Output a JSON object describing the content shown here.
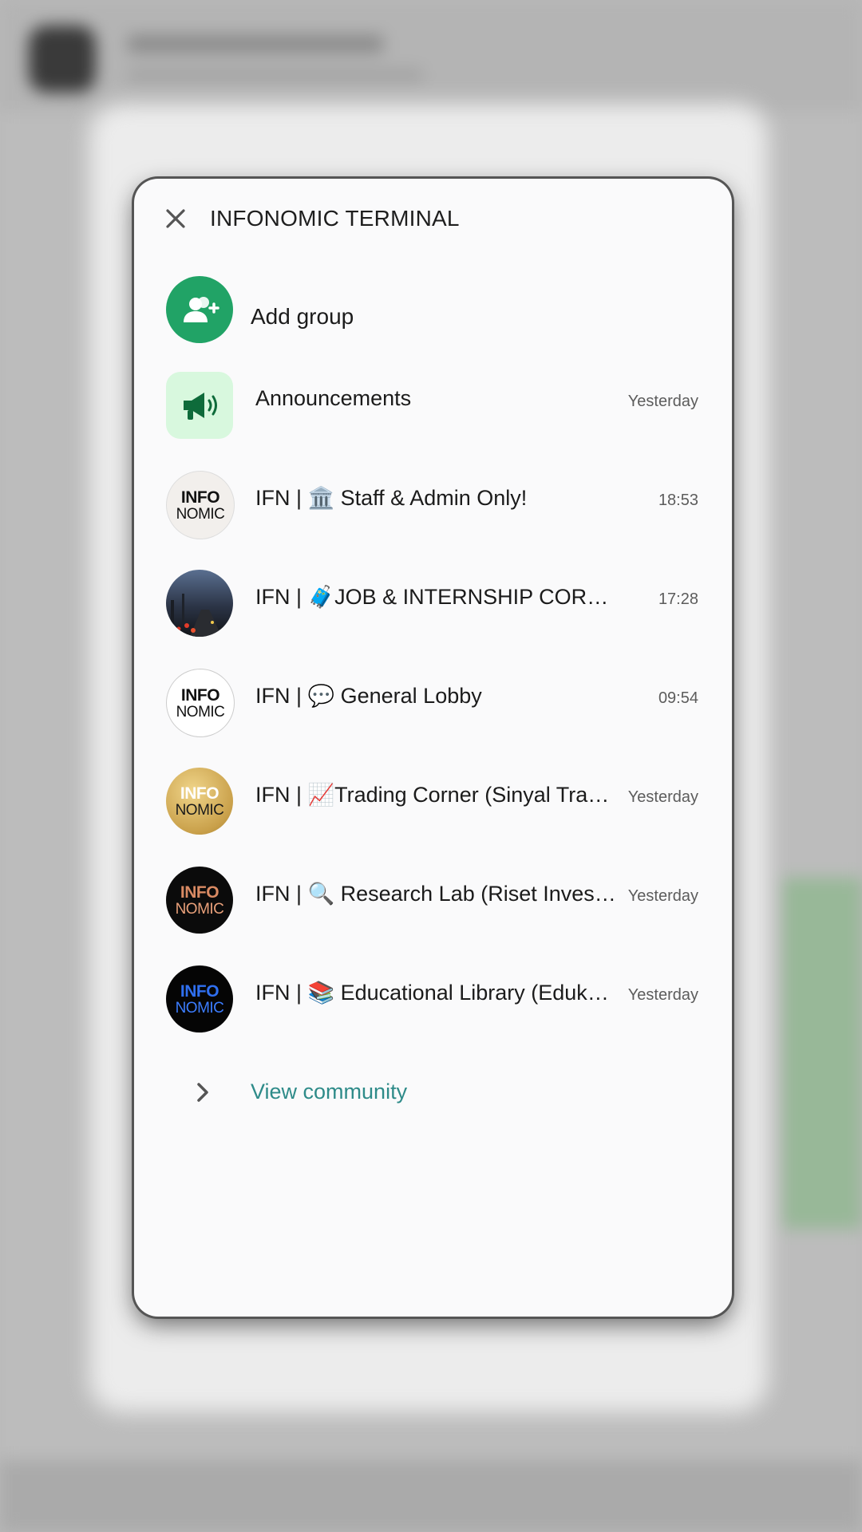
{
  "background": {
    "blurred": true
  },
  "panel": {
    "title": "INFONOMIC TERMINAL",
    "close_icon": "close-icon"
  },
  "add_group": {
    "label": "Add group",
    "icon": "add-group-icon",
    "color": "#21a366"
  },
  "groups": [
    {
      "name": "Announcements",
      "time": "Yesterday",
      "avatar": "megaphone-icon"
    },
    {
      "name": "IFN | 🏛️ Staff & Admin Only!",
      "time": "18:53",
      "avatar": "infonomic-logo"
    },
    {
      "name": "IFN | 🧳JOB & INTERNSHIP CORNER",
      "time": "17:28",
      "avatar": "city-photo"
    },
    {
      "name": "IFN | 💬 General Lobby",
      "time": "09:54",
      "avatar": "infonomic-logo"
    },
    {
      "name": "IFN | 📈Trading Corner (Sinyal Tradi…",
      "time": "Yesterday",
      "avatar": "infonomic-logo-gold"
    },
    {
      "name": "IFN | 🔍 Research Lab (Riset Invest…",
      "time": "Yesterday",
      "avatar": "infonomic-logo-black"
    },
    {
      "name": "IFN | 📚 Educational Library (Eduka…",
      "time": "Yesterday",
      "avatar": "infonomic-logo-blue"
    }
  ],
  "logo_text": {
    "line1": "INFO",
    "line2": "NOMIC"
  },
  "view_community": {
    "label": "View community",
    "icon": "chevron-right-icon",
    "color": "#2e8b89"
  }
}
